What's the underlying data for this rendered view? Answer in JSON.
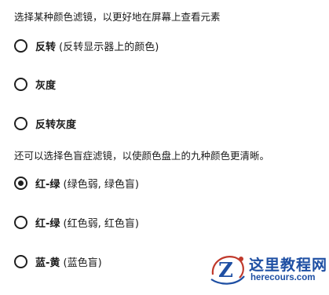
{
  "intro_text": "选择某种颜色滤镜，以更好地在屏幕上查看元素",
  "filters": [
    {
      "label": "反转",
      "note": " (反转显示器上的颜色)",
      "checked": false
    },
    {
      "label": "灰度",
      "note": "",
      "checked": false
    },
    {
      "label": "反转灰度",
      "note": "",
      "checked": false
    }
  ],
  "colorblind_intro": "还可以选择色盲症滤镜，以使颜色盘上的九种颜色更清晰。",
  "colorblind_filters": [
    {
      "label": "红-绿",
      "note": " (绿色弱, 绿色盲)",
      "checked": true
    },
    {
      "label": "红-绿",
      "note": " (红色弱, 红色盲)",
      "checked": false
    },
    {
      "label": "蓝-黄",
      "note": " (蓝色盲)",
      "checked": false
    }
  ],
  "watermark": {
    "title": "这里教程网",
    "url": "herecours.com",
    "logo_letter": "Z",
    "color": "#1e4fa3",
    "accent": "#c0392b"
  }
}
